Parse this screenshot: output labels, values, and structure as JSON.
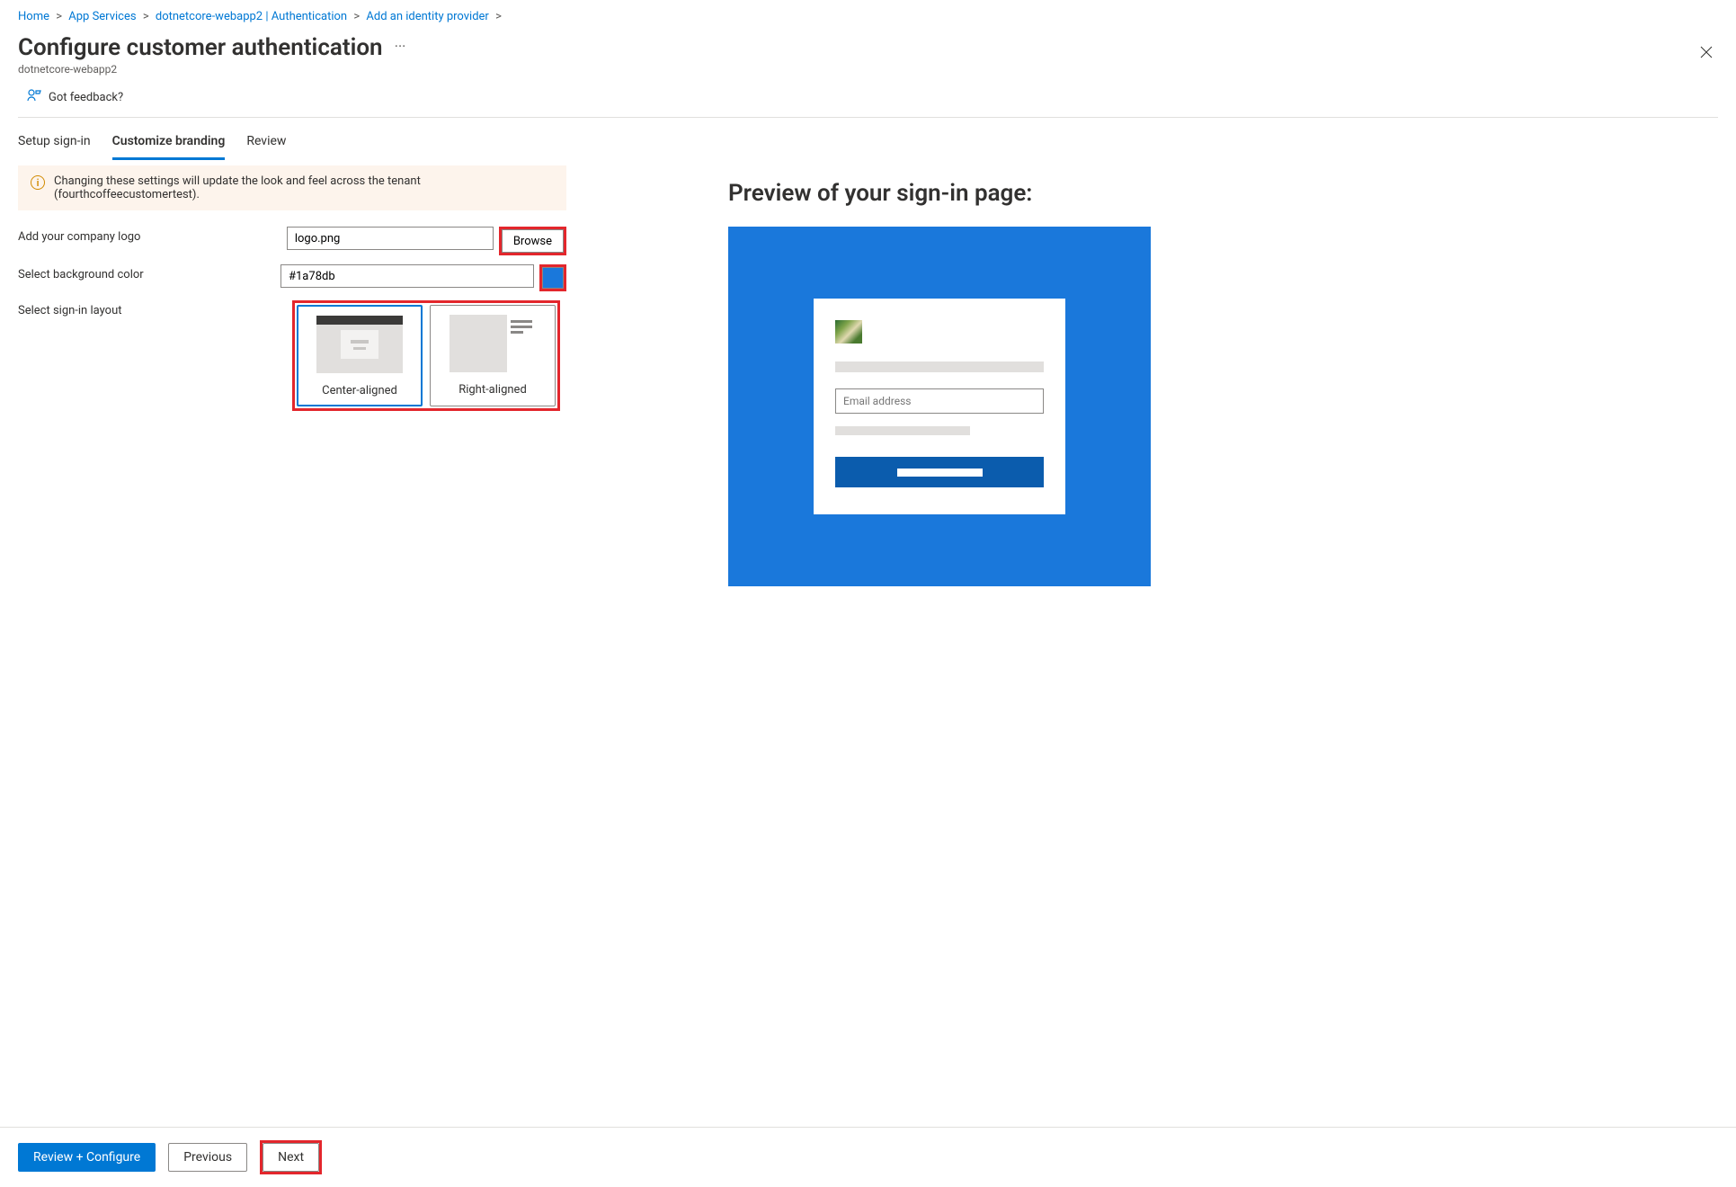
{
  "breadcrumb": {
    "items": [
      "Home",
      "App Services",
      "dotnetcore-webapp2 | Authentication",
      "Add an identity provider"
    ]
  },
  "header": {
    "title": "Configure customer authentication",
    "subtitle": "dotnetcore-webapp2"
  },
  "feedback": {
    "label": "Got feedback?"
  },
  "tabs": {
    "items": [
      "Setup sign-in",
      "Customize branding",
      "Review"
    ],
    "active_index": 1
  },
  "banner": {
    "text": "Changing these settings will update the look and feel across the tenant (fourthcoffeecustomertest)."
  },
  "form": {
    "logo_label": "Add your company logo",
    "logo_value": "logo.png",
    "browse_label": "Browse",
    "bg_label": "Select background color",
    "bg_value": "#1a78db",
    "layout_label": "Select sign-in layout",
    "layout_options": {
      "center": "Center-aligned",
      "right": "Right-aligned"
    },
    "layout_selected": "center"
  },
  "preview": {
    "title": "Preview of your sign-in page:",
    "email_placeholder": "Email address",
    "bg_color": "#1a78db"
  },
  "footer": {
    "review": "Review + Configure",
    "previous": "Previous",
    "next": "Next"
  }
}
